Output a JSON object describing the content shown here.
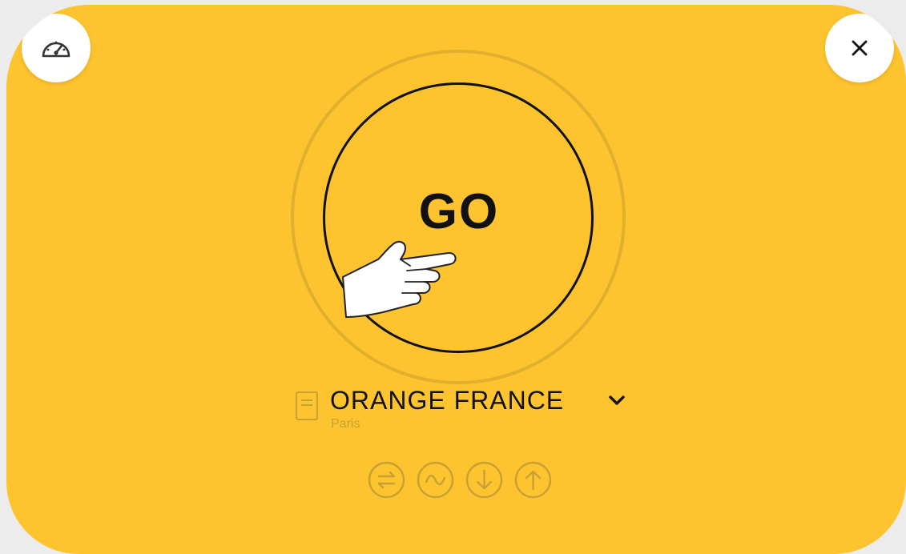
{
  "colors": {
    "background": "#fec42f",
    "button_bg": "#ffffff",
    "go_ring": "#111111",
    "muted": "#c8a033"
  },
  "top_left_button": {
    "icon": "speedometer-icon"
  },
  "top_right_button": {
    "icon": "close-icon"
  },
  "go_button": {
    "label": "GO"
  },
  "server": {
    "name": "ORANGE FRANCE",
    "city": "Paris",
    "icon": "server-icon",
    "dropdown_icon": "chevron-down-icon"
  },
  "metrics": [
    {
      "icon": "ping-icon"
    },
    {
      "icon": "jitter-icon"
    },
    {
      "icon": "download-icon"
    },
    {
      "icon": "upload-icon"
    }
  ]
}
